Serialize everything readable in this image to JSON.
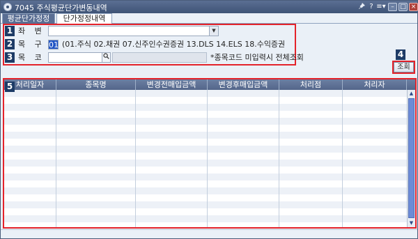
{
  "window": {
    "title": "7045 주식평균단가변동내역",
    "controls": {
      "pin_icon": "pin-icon",
      "help": "?",
      "menu": "≡▾",
      "minimize": "–",
      "maximize": "□",
      "close": "×"
    }
  },
  "tabs": [
    {
      "label": "평균단가정정",
      "active": true
    },
    {
      "label": "단가정정내역",
      "active": false
    }
  ],
  "form": {
    "account": {
      "badge": "1",
      "label": "좌 변 호",
      "value": "",
      "dropdown_icon": "▼"
    },
    "item_type": {
      "badge": "2",
      "label": "목 구 분",
      "value": "01",
      "hint": "(01.주식 02.채권 07.신주인수권증권 13.DLS 14.ELS 18.수익증권"
    },
    "item_code": {
      "badge": "3",
      "label": "목 코 드",
      "value": "",
      "search_icon": "🔍",
      "name_value": "",
      "note": "*종목코드 미입력시 전체조회"
    }
  },
  "query": {
    "badge": "4",
    "label": "조회"
  },
  "grid": {
    "badge": "5",
    "columns": [
      "처리일자",
      "종목명",
      "변경전매입금액",
      "변경후매입금액",
      "처리점",
      "처리자"
    ],
    "rows": []
  },
  "colors": {
    "annotation_border": "#e4222a",
    "badge_bg": "#1d3b66",
    "titlebar": "#4b5f83",
    "grid_header": "#5f7296"
  }
}
